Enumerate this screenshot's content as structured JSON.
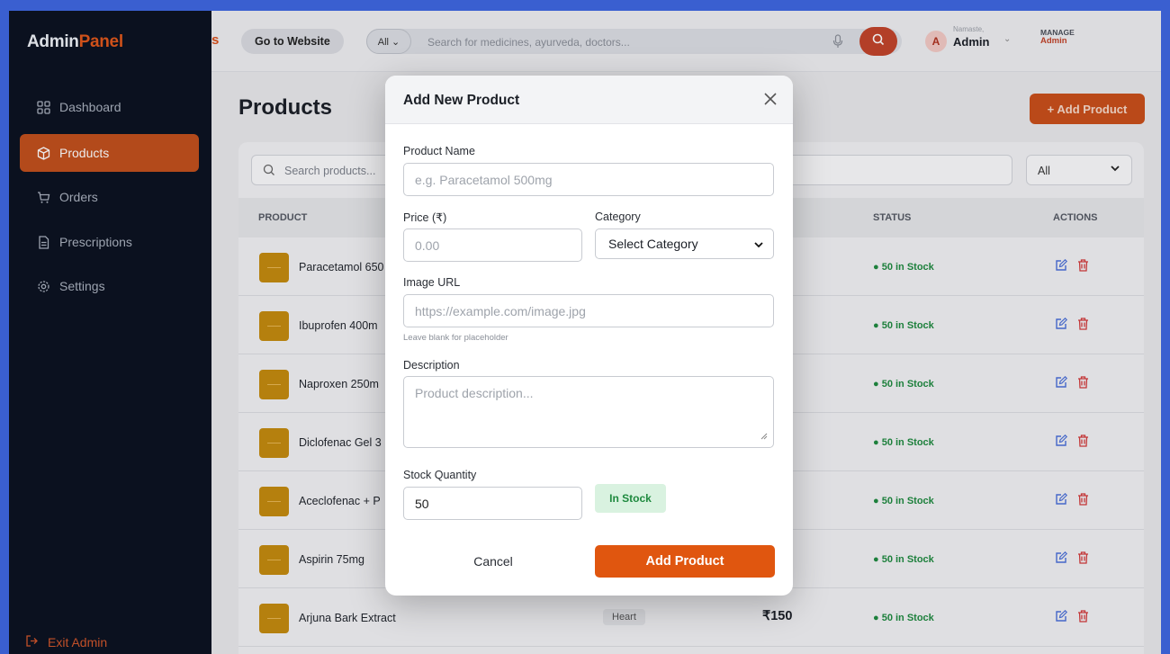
{
  "sidebar": {
    "logo_part1": "Admin",
    "logo_part2": "Panel",
    "items": [
      {
        "label": "Dashboard",
        "icon": "grid-icon"
      },
      {
        "label": "Products",
        "icon": "box-icon"
      },
      {
        "label": "Orders",
        "icon": "cart-icon"
      },
      {
        "label": "Prescriptions",
        "icon": "file-icon"
      },
      {
        "label": "Settings",
        "icon": "gear-icon"
      }
    ],
    "exit_label": "Exit Admin"
  },
  "topbar": {
    "cut_letter": "s",
    "go_website": "Go to Website",
    "filter_label": "All ⌄",
    "search_placeholder": "Search for medicines, ayurveda, doctors...",
    "avatar_letter": "A",
    "greeting": "Namaste,",
    "user_name": "Admin",
    "manage_line1": "MANAGE",
    "manage_line2": "Admin"
  },
  "main": {
    "title": "Products",
    "add_button": "+  Add Product",
    "search_placeholder": "Search products...",
    "filter_value": "All",
    "columns": {
      "product": "PRODUCT",
      "status": "STATUS",
      "actions": "ACTIONS"
    },
    "rows": [
      {
        "name": "Paracetamol 650",
        "status": "● 50 in Stock"
      },
      {
        "name": "Ibuprofen 400m",
        "status": "● 50 in Stock"
      },
      {
        "name": "Naproxen 250m",
        "status": "● 50 in Stock"
      },
      {
        "name": "Diclofenac Gel 3",
        "status": "● 50 in Stock"
      },
      {
        "name": "Aceclofenac + P",
        "status": "● 50 in Stock"
      },
      {
        "name": "Aspirin 75mg",
        "status": "● 50 in Stock"
      },
      {
        "name": "Arjuna Bark Extract",
        "category": "Heart",
        "price": "₹150",
        "status": "● 50 in Stock"
      }
    ]
  },
  "modal": {
    "title": "Add New Product",
    "product_name_label": "Product Name",
    "product_name_placeholder": "e.g. Paracetamol 500mg",
    "price_label": "Price (₹)",
    "price_placeholder": "0.00",
    "category_label": "Category",
    "category_value": "Select Category",
    "image_url_label": "Image URL",
    "image_url_placeholder": "https://example.com/image.jpg",
    "image_hint": "Leave blank for placeholder",
    "description_label": "Description",
    "description_placeholder": "Product description...",
    "stock_label": "Stock Quantity",
    "stock_value": "50",
    "stock_badge": "In Stock",
    "cancel_label": "Cancel",
    "submit_label": "Add Product"
  },
  "colors": {
    "accent": "#e0560f",
    "sidebar_bg": "#0b1220",
    "stock_green": "#1f8a3f"
  }
}
